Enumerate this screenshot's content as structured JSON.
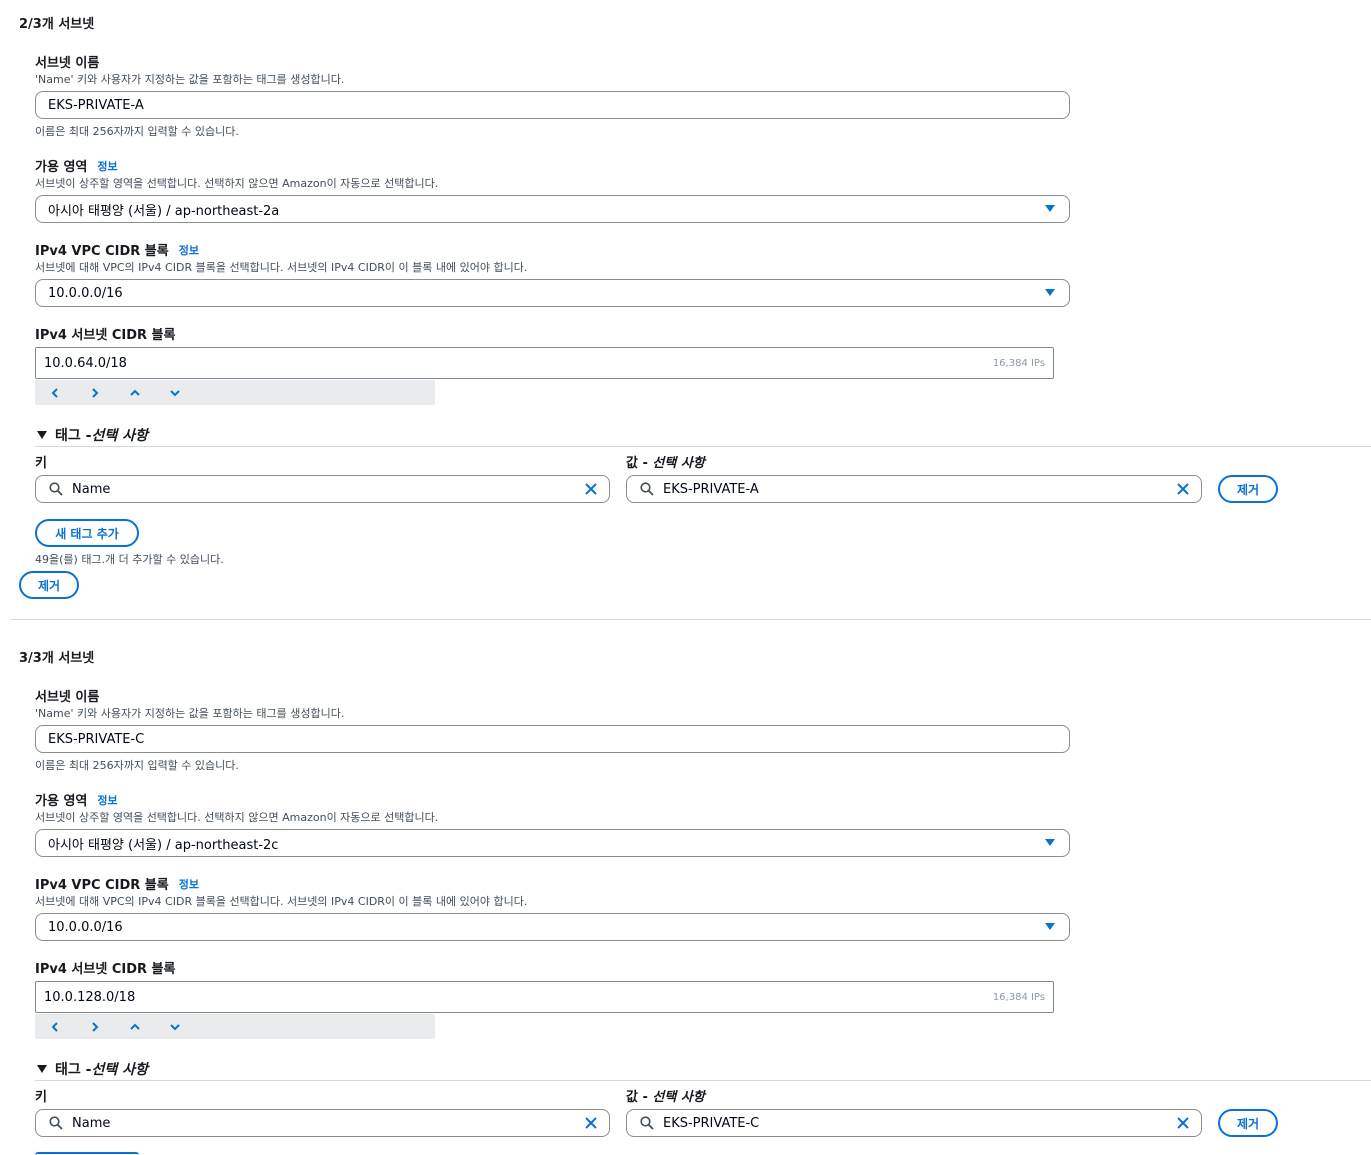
{
  "common": {
    "name_label": "서브넷 이름",
    "name_desc": "'Name' 키와 사용자가 지정하는 값을 포함하는 태그를 생성합니다.",
    "name_hint": "이름은 최대 256자까지 입력할 수 있습니다.",
    "az_label": "가용 영역",
    "info_link": "정보",
    "az_desc": "서브넷이 상주할 영역을 선택합니다. 선택하지 않으면 Amazon이 자동으로 선택합니다.",
    "vpc_cidr_label": "IPv4 VPC CIDR 블록",
    "vpc_cidr_desc": "서브넷에 대해 VPC의 IPv4 CIDR 블록을 선택합니다. 서브넷의 IPv4 CIDR이 이 블록 내에 있어야 합니다.",
    "subnet_cidr_label": "IPv4 서브넷 CIDR 블록",
    "tags_toggle_main": "태그 - ",
    "tags_toggle_italic": "선택 사항",
    "key_col_label": "키",
    "value_col_main": "값 - ",
    "value_col_italic": "선택 사항",
    "remove_button": "제거",
    "add_tag_button": "새 태그 추가",
    "remaining_tags": "49을(를) 태그.개 더 추가할 수 있습니다."
  },
  "subnets": [
    {
      "heading": "2/3개 서브넷",
      "name_value": "EKS-PRIVATE-A",
      "az_value": "아시아 태평양 (서울) / ap-northeast-2a",
      "vpc_cidr_value": "10.0.0.0/16",
      "subnet_cidr_value": "10.0.64.0/18",
      "ip_count": "16,384 IPs",
      "tag_key": "Name",
      "tag_value": "EKS-PRIVATE-A"
    },
    {
      "heading": "3/3개 서브넷",
      "name_value": "EKS-PRIVATE-C",
      "az_value": "아시아 태평양 (서울) / ap-northeast-2c",
      "vpc_cidr_value": "10.0.0.0/16",
      "subnet_cidr_value": "10.0.128.0/18",
      "ip_count": "16,384 IPs",
      "tag_key": "Name",
      "tag_value": "EKS-PRIVATE-C"
    }
  ]
}
